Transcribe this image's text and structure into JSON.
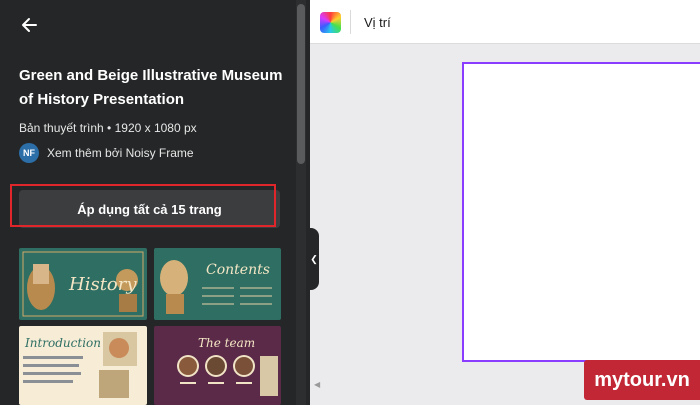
{
  "panel": {
    "title": "Green and Beige Illustrative Museum of History Presentation",
    "meta": "Bản thuyết trình • 1920 x 1080 px",
    "author": {
      "initials": "NF",
      "text": "Xem thêm bởi Noisy Frame"
    },
    "apply_button": "Áp dụng tất cả 15 trang",
    "thumbnails": [
      {
        "label": "History"
      },
      {
        "label": "Contents"
      },
      {
        "label": "Introduction"
      },
      {
        "label": "The team"
      }
    ]
  },
  "topbar": {
    "position_label": "Vị trí"
  },
  "watermark": "mytour.vn",
  "colors": {
    "panel_bg": "#252627",
    "highlight": "#e0262b",
    "canvas_selection": "#8b3dff",
    "watermark_bg": "#c12734"
  },
  "icons": [
    "back-arrow-icon",
    "color-palette-icon",
    "chevron-left-icon",
    "scroll-left-icon"
  ]
}
